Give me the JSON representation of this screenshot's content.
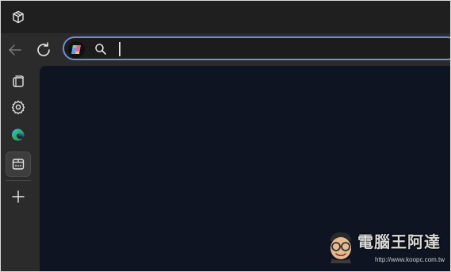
{
  "titlebar": {
    "workspaces_icon": "workspaces-icon"
  },
  "toolbar": {
    "back_icon": "arrow-left-icon",
    "refresh_icon": "refresh-icon",
    "address_bar": {
      "copilot_icon": "copilot-icon",
      "search_icon": "search-icon",
      "value": "",
      "placeholder": ""
    },
    "accent_color": "#6e8fd6"
  },
  "sidebar": {
    "items": [
      {
        "icon": "tab-actions-icon",
        "active": false
      },
      {
        "icon": "gear-icon",
        "active": false
      },
      {
        "icon": "edge-logo-icon",
        "active": false
      },
      {
        "icon": "app-panel-icon",
        "active": true
      },
      {
        "icon": "plus-icon",
        "active": false
      }
    ]
  },
  "content": {
    "background": "#0f1423"
  },
  "watermark": {
    "title": "電腦王阿達",
    "url": "http://www.koopc.com.tw"
  }
}
